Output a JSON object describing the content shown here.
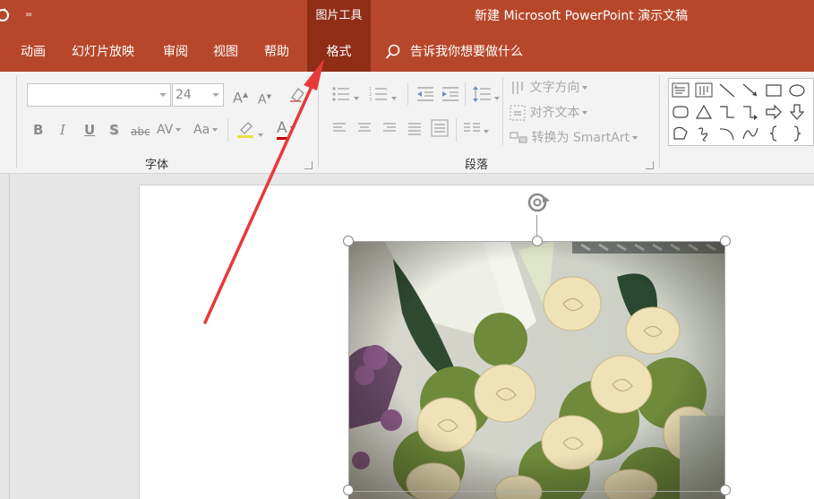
{
  "titlebar": {
    "contextual_group": "图片工具",
    "app_title": "新建 Microsoft PowerPoint 演示文稿",
    "qa_more": "="
  },
  "tabs": [
    {
      "label": "动画"
    },
    {
      "label": "幻灯片放映"
    },
    {
      "label": "审阅"
    },
    {
      "label": "视图"
    },
    {
      "label": "帮助"
    },
    {
      "label": "格式"
    }
  ],
  "tell_me": "告诉我你想要做什么",
  "ribbon": {
    "font_group": {
      "label": "字体",
      "font_name": "",
      "font_size": "24",
      "grow_font": "A",
      "shrink_font": "A",
      "bold": "B",
      "italic": "I",
      "underline": "U",
      "shadow": "S",
      "strikethrough": "abc",
      "spacing": "AV",
      "change_case": "Aa",
      "font_color": "A"
    },
    "paragraph_group": {
      "label": "段落",
      "text_direction": "文字方向",
      "align_text": "对齐文本",
      "convert_smartart": "转换为 SmartArt"
    }
  },
  "colors": {
    "accent": "#b7472a",
    "accent_dark": "#8f2d17",
    "arrow": "#e8393a"
  }
}
